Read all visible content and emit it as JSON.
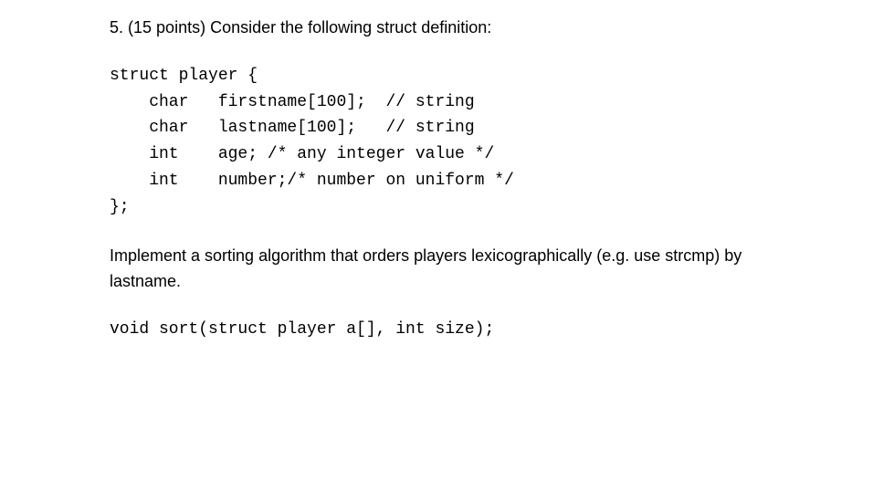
{
  "question": {
    "number": "5.",
    "points": "(15 points)",
    "prompt": "Consider the following struct definition:"
  },
  "code": {
    "line1": "struct player {",
    "line2": "    char   firstname[100];  // string",
    "line3": "    char   lastname[100];   // string",
    "line4": "    int    age; /* any integer value */",
    "line5": "    int    number;/* number on uniform */",
    "line6": "};"
  },
  "instruction": "Implement a sorting algorithm that orders players lexicographically (e.g. use strcmp) by lastname.",
  "signature": "void sort(struct player a[], int size);"
}
